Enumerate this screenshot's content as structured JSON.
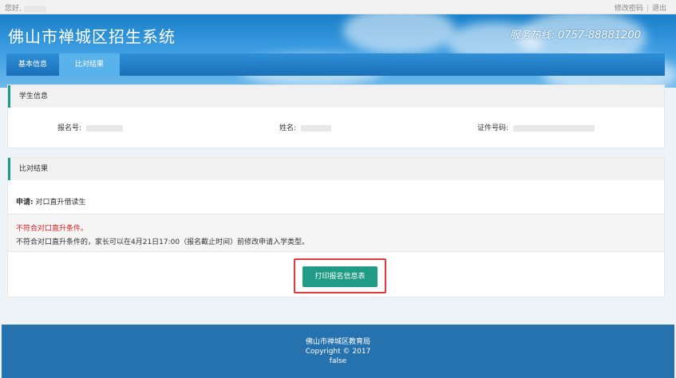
{
  "topbar": {
    "greeting": "您好,",
    "links": [
      "修改密码",
      "退出"
    ],
    "separator": "|"
  },
  "header": {
    "title": "佛山市禅城区招生系统",
    "hotline": "服务热线: 0757-88881200"
  },
  "nav": {
    "tabs": [
      {
        "label": "基本信息",
        "active": false
      },
      {
        "label": "比对结果",
        "active": true
      }
    ]
  },
  "student_info": {
    "title": "学生信息",
    "fields": [
      {
        "label": "报名号:"
      },
      {
        "label": "姓名:"
      },
      {
        "label": "证件号码:"
      }
    ]
  },
  "compare_result": {
    "title": "比对结果",
    "apply_label": "申请:",
    "apply_value": "对口直升借读生",
    "warn_title": "不符合对口直升条件。",
    "warn_text": "不符合对口直升条件的，家长可以在4月21日17:00（报名截止时间）前修改申请入学类型。",
    "print_button": "打印报名信息表"
  },
  "footer": {
    "org": "佛山市禅城区教育局",
    "copyright": "Copyright © 2017",
    "extra": "false"
  },
  "colors": {
    "accent_teal": "#1f9b86",
    "nav_blue": "#1a70b8",
    "active_tab": "#59b2ea",
    "footer_blue": "#2672ae",
    "warn_red": "#e02020",
    "highlight_outline": "#e23a3a"
  }
}
